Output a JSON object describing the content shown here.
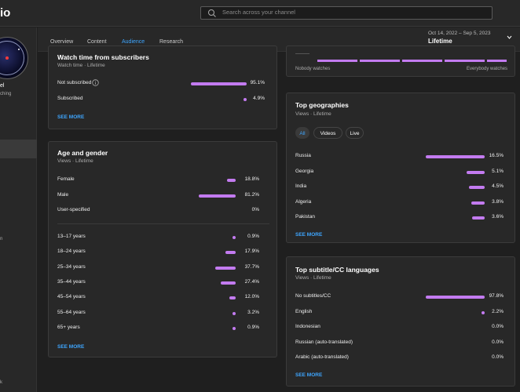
{
  "header": {
    "logo_fragment": "io",
    "search_placeholder": "Search across your channel"
  },
  "sidebar": {
    "channel_name_fragment": "el",
    "channel_sub_fragment": "ching",
    "item_fragment_1": "n",
    "item_fragment_2": "k"
  },
  "tabs": [
    "Overview",
    "Content",
    "Audience",
    "Research"
  ],
  "active_tab": "Audience",
  "period": {
    "range": "Oct 14, 2022 – Sep 5, 2023",
    "label": "Lifetime"
  },
  "watch_subs": {
    "title": "Watch time from subscribers",
    "subtitle": "Watch time · Lifetime",
    "rows": [
      {
        "label": "Not subscribed",
        "value": "95.1%",
        "pct": 95.1
      },
      {
        "label": "Subscribed",
        "value": "4.9%",
        "pct": 4.9
      }
    ],
    "see_more": "SEE MORE"
  },
  "age_gender": {
    "title": "Age and gender",
    "subtitle": "Views · Lifetime",
    "gender": [
      {
        "label": "Female",
        "value": "18.8%",
        "pct": 18.8
      },
      {
        "label": "Male",
        "value": "81.2%",
        "pct": 81.2
      },
      {
        "label": "User-specified",
        "value": "0%",
        "pct": 0
      }
    ],
    "ages": [
      {
        "label": "13–17 years",
        "value": "0.9%",
        "pct": 0.9
      },
      {
        "label": "18–24 years",
        "value": "17.9%",
        "pct": 17.9
      },
      {
        "label": "25–34 years",
        "value": "37.7%",
        "pct": 37.7
      },
      {
        "label": "35–44 years",
        "value": "27.4%",
        "pct": 27.4
      },
      {
        "label": "45–54 years",
        "value": "12.0%",
        "pct": 12.0
      },
      {
        "label": "55–64 years",
        "value": "3.2%",
        "pct": 3.2
      },
      {
        "label": "65+ years",
        "value": "0.9%",
        "pct": 0.9
      }
    ],
    "see_more": "SEE MORE"
  },
  "audience_scale": {
    "left_label": "Nobody watches",
    "right_label": "Everybody watches"
  },
  "geographies": {
    "title": "Top geographies",
    "subtitle": "Views · Lifetime",
    "chips": [
      "All",
      "Videos",
      "Live"
    ],
    "selected_chip": "All",
    "rows": [
      {
        "label": "Russia",
        "value": "16.5%",
        "pct": 16.5
      },
      {
        "label": "Georgia",
        "value": "5.1%",
        "pct": 5.1
      },
      {
        "label": "India",
        "value": "4.5%",
        "pct": 4.5
      },
      {
        "label": "Algeria",
        "value": "3.8%",
        "pct": 3.8
      },
      {
        "label": "Pakistan",
        "value": "3.6%",
        "pct": 3.6
      }
    ],
    "see_more": "SEE MORE"
  },
  "subtitles": {
    "title": "Top subtitle/CC languages",
    "subtitle": "Views · Lifetime",
    "rows": [
      {
        "label": "No subtitles/CC",
        "value": "97.8%",
        "pct": 97.8
      },
      {
        "label": "English",
        "value": "2.2%",
        "pct": 2.2
      },
      {
        "label": "Indonesian",
        "value": "0.0%",
        "pct": 0
      },
      {
        "label": "Russian (auto-translated)",
        "value": "0.0%",
        "pct": 0
      },
      {
        "label": "Arabic (auto-translated)",
        "value": "0.0%",
        "pct": 0
      }
    ],
    "see_more": "SEE MORE"
  },
  "colors": {
    "bar": "#c37bf0",
    "accent": "#3ea6ff",
    "card_bg": "#282828",
    "page_bg": "#1f1f1f"
  }
}
